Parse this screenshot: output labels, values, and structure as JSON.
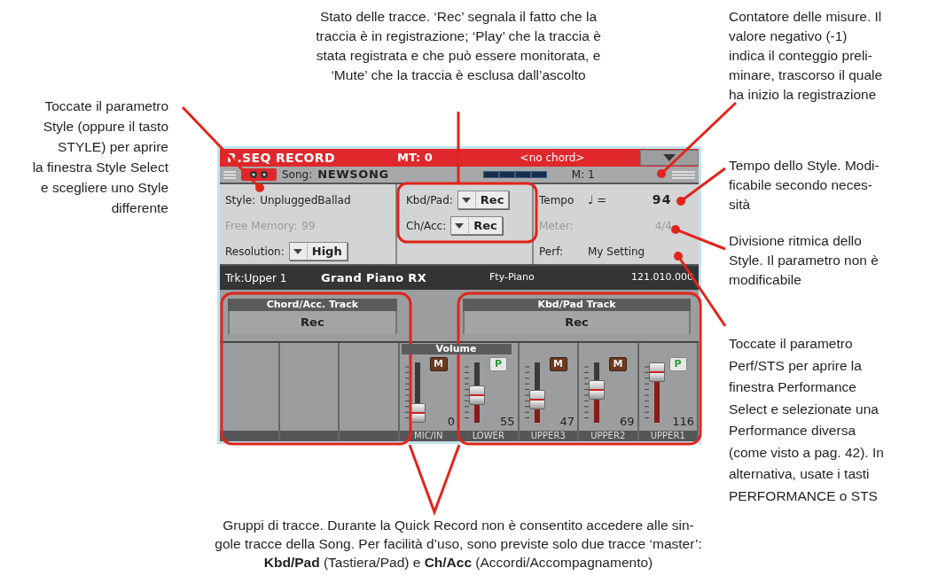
{
  "annotations": {
    "top": {
      "lines": [
        "Stato delle tracce. ‘Rec’ segnala il fatto che la",
        "traccia è in registrazione; ‘Play’ che la traccia è",
        "stata registrata e che può essere monitorata, e",
        "‘Mute’ che la traccia è esclusa dall’ascolto"
      ]
    },
    "left": {
      "lines": [
        "Toccate il parametro",
        "Style (oppure il tasto",
        "STYLE) per aprire",
        "la finestra Style Select",
        "e scegliere uno Style",
        "differente"
      ]
    },
    "measure": {
      "lines": [
        "Contatore delle misure. Il",
        "valore negativo (-1)",
        "indica il conteggio preli-",
        "minare, trascorso il quale",
        "ha inizio la registrazione"
      ]
    },
    "tempo": {
      "lines": [
        "Tempo dello Style. Modi-",
        "ficabile secondo neces-",
        "sità"
      ]
    },
    "meter": {
      "lines": [
        "Divisione ritmica dello",
        "Style. Il parametro non è",
        "modificabile"
      ]
    },
    "perf": {
      "lines": [
        "Toccate il parametro",
        "Perf/STS per aprire la",
        "finestra Performance",
        "Select e selezionate una",
        "Performance diversa",
        "(come visto a pag. 42). In",
        "alternativa, usate i tasti",
        "PERFORMANCE o STS"
      ]
    },
    "bottom": {
      "lines": [
        "Gruppi di tracce. Durante la Quick Record non è consentito accedere alle sin-",
        "gole tracce della Song. Per facilità d’uso, sono previste solo due tracce ‘master’:",
        "**Kbd/Pad** (Tastiera/Pad) e **Ch/Acc** (Accordi/Accompagnamento)"
      ]
    }
  },
  "screen": {
    "title_bar": {
      "title": "R.SEQ RECORD",
      "mt": "MT: 0",
      "chord": "<no chord>"
    },
    "song_bar": {
      "label": "Song:",
      "name": "NEWSONG",
      "measure": "M: 1"
    },
    "left_params": [
      {
        "kind": "text",
        "label": "Style:",
        "value": "UnpluggedBallad",
        "disabled": false
      },
      {
        "kind": "text",
        "label": "Free Memory:",
        "value": "99",
        "disabled": true
      },
      {
        "kind": "menu",
        "label": "Resolution:",
        "value": "High",
        "disabled": false
      }
    ],
    "middle_params": [
      {
        "kind": "menu",
        "label": "Kbd/Pad:",
        "value": "Rec",
        "disabled": false
      },
      {
        "kind": "menu",
        "label": "Ch/Acc:",
        "value": "Rec",
        "disabled": false
      }
    ],
    "right_params": [
      {
        "kind": "tempo",
        "label": "Tempo",
        "symbol": "♩ =",
        "value": "94",
        "disabled": false
      },
      {
        "kind": "text",
        "label": "Meter:",
        "value": "4/4",
        "disabled": true
      },
      {
        "kind": "text",
        "label": "Perf:",
        "value": "My Setting",
        "disabled": false
      }
    ],
    "track_bar": {
      "track": "Trk:Upper 1",
      "sound": "Grand Piano RX",
      "bank": "Fty-Piano",
      "program": "121.010.000"
    },
    "track_groups": [
      {
        "title": "Chord/Acc. Track",
        "status": "Rec"
      },
      {
        "title": "Kbd/Pad Track",
        "status": "Rec"
      }
    ],
    "mixer": {
      "header": "Volume",
      "channels": [
        {
          "kind": "empty"
        },
        {
          "kind": "empty"
        },
        {
          "kind": "empty"
        },
        {
          "kind": "mute",
          "badge": "M",
          "value": "0",
          "name": "MIC/IN",
          "level": 0.08
        },
        {
          "kind": "play",
          "badge": "P",
          "value": "55",
          "name": "LOWER",
          "level": 0.45
        },
        {
          "kind": "mute",
          "badge": "M",
          "value": "47",
          "name": "UPPER3",
          "level": 0.38
        },
        {
          "kind": "mute",
          "badge": "M",
          "value": "69",
          "name": "UPPER2",
          "level": 0.55
        },
        {
          "kind": "play",
          "badge": "P",
          "value": "116",
          "name": "UPPER1",
          "level": 0.93
        }
      ]
    }
  }
}
